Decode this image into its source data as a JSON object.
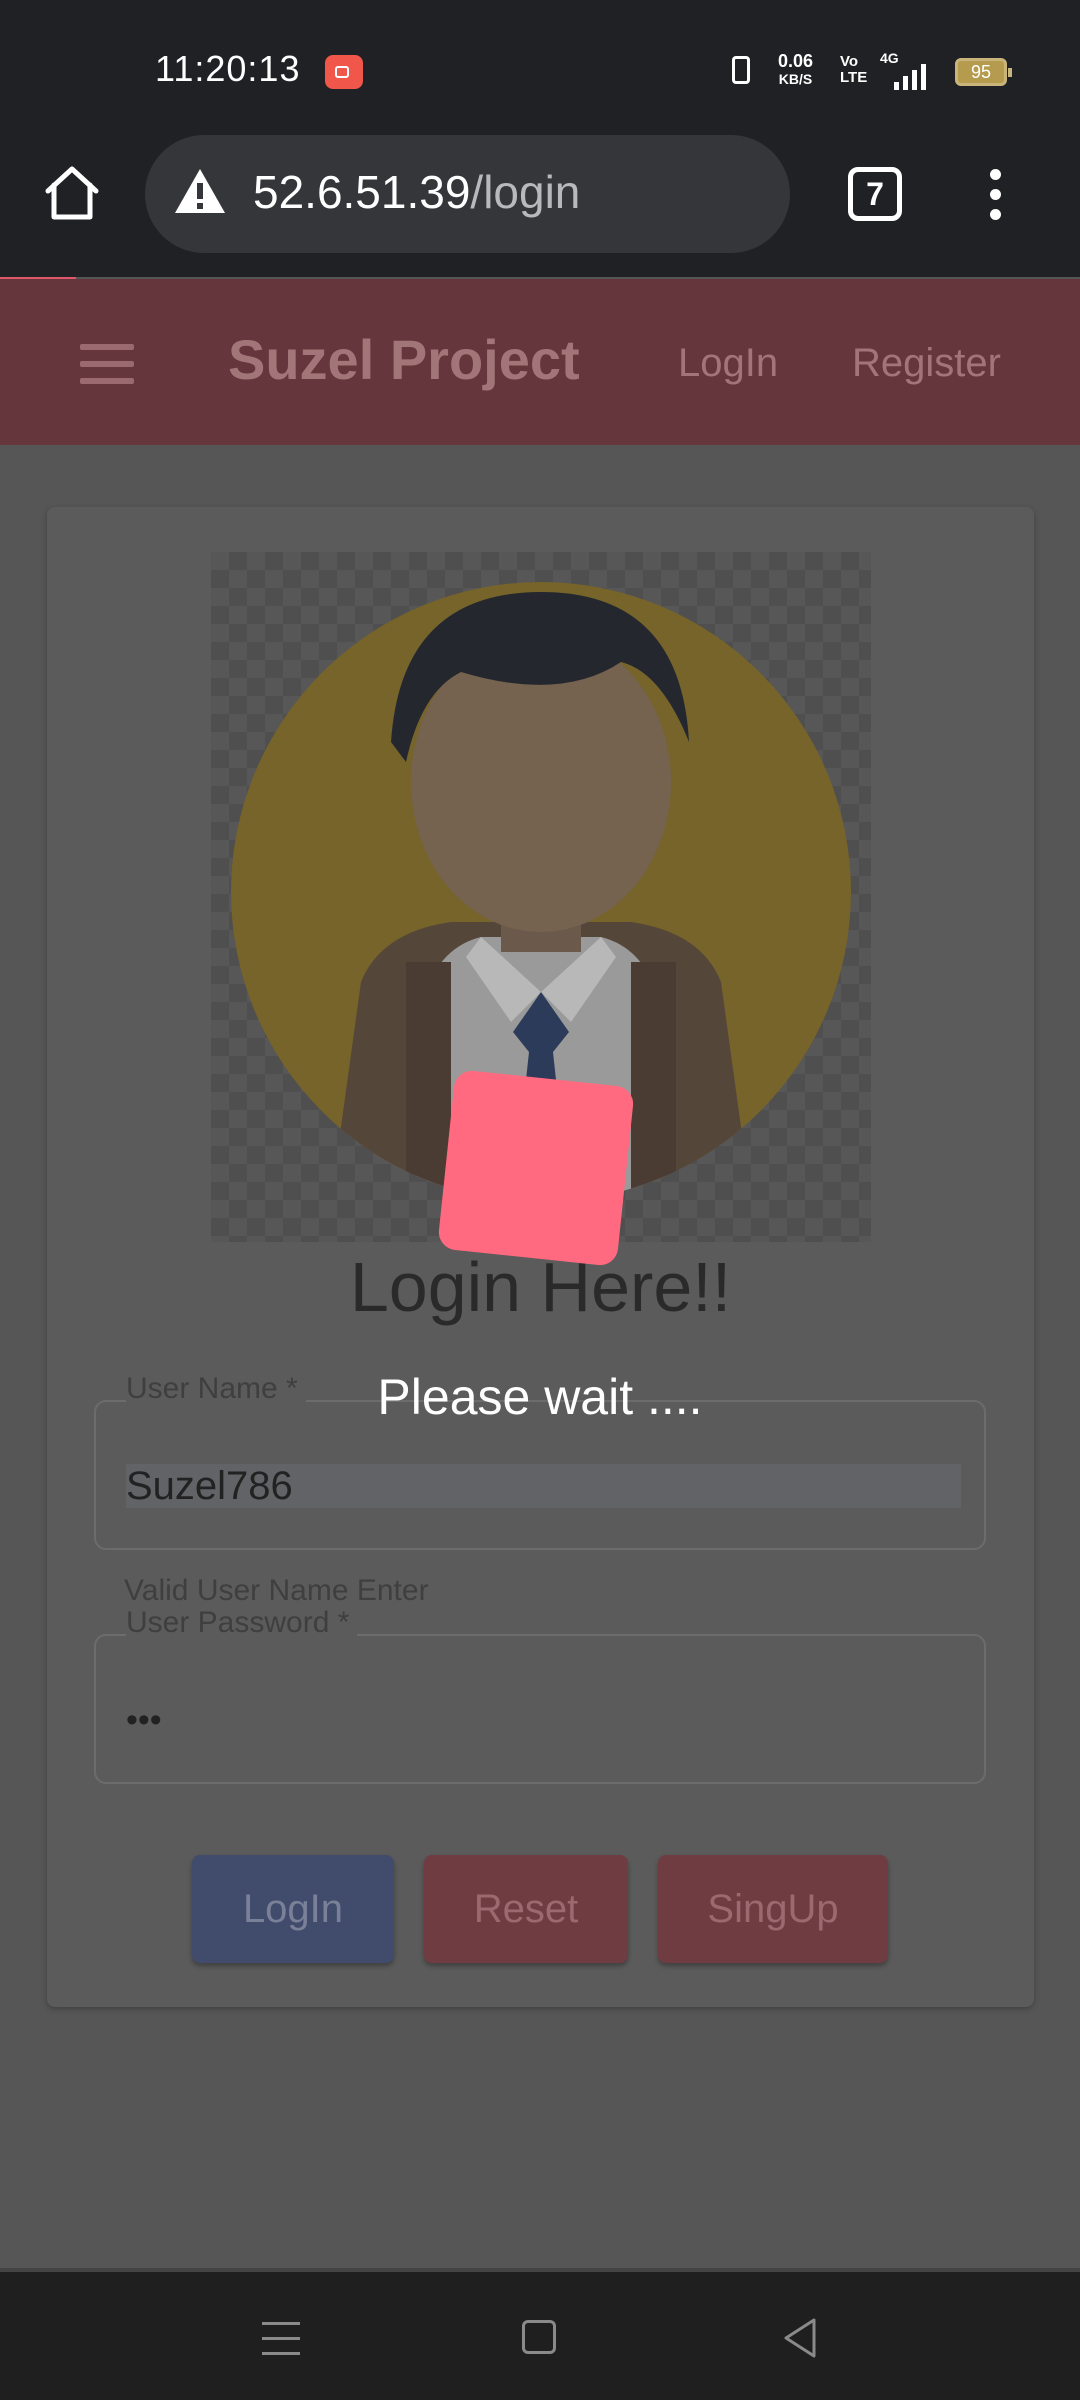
{
  "status_bar": {
    "time": "11:20:13",
    "net_speed": "0.06",
    "net_speed_unit": "KB/S",
    "volte": "Vo\nLTE",
    "network": "4G",
    "battery": "95"
  },
  "browser": {
    "url_host": "52.6.51.39",
    "url_path": "/login",
    "tab_count": "7",
    "page_load_progress": 0.07
  },
  "navbar": {
    "brand": "Suzel Project",
    "links": [
      "LogIn",
      "Register"
    ]
  },
  "login_form": {
    "heading": "Login Here!!",
    "username_label": "User Name *",
    "username_value": "Suzel786",
    "username_helper": "Valid User Name Enter",
    "password_label": "User Password *",
    "password_value": "•••",
    "buttons": {
      "login": "LogIn",
      "reset": "Reset",
      "signup": "SingUp"
    }
  },
  "loading_overlay": {
    "message": "Please wait ...."
  },
  "colors": {
    "navbar": "#65373c",
    "login_button": "#414b6b",
    "reset_button": "#6f3c42",
    "signup_button": "#6f3c42",
    "loader": "#ff6a80"
  },
  "system_nav": {
    "icons": [
      "menu-icon",
      "home-square-icon",
      "back-triangle-icon"
    ]
  }
}
